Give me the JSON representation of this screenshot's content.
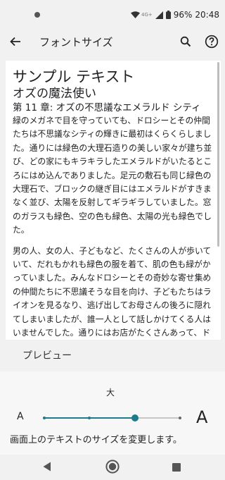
{
  "status_bar": {
    "network_label": "4G+",
    "battery": "96%",
    "time": "20:48"
  },
  "app_bar": {
    "title": "フォントサイズ",
    "back_icon": "arrow-back-icon",
    "search_icon": "search-icon",
    "help_icon": "help-icon"
  },
  "preview": {
    "sample_title": "サンプル テキスト",
    "book_title": "オズの魔法使い",
    "chapter": "第 11 章: オズの不思議なエメラルド シティ",
    "paragraphs": [
      "緑のメガネで目を守っていても、ドロシーとその仲間たちは不思議なシティの輝きに最初はくらくらしました。通りには緑色の大理石造りの美しい家々が建ち並び、どの家にもキラキラしたエメラルドがいたるところにはめ込んでありました。足元の敷石も同じ緑色の大理石で、ブロックの継ぎ目にはエメラルドがすきまなく並び、太陽を反射してギラギラしていました。窓のガラスも緑色、空の色も緑色、太陽の光も緑色でした。",
      "男の人、女の人、子どもなど、たくさんの人が歩いていて、だれもかれも緑色の服を着て、肌の色も緑がかっていました。みんなドロシーとその奇妙な寄せ集めの仲間たちに不思議そうな目を向け、子どもたちはライオンを見るなり、逃げ出してお母さんの後ろに隠れてしまいましたが、誰一人として話しかけてくる人はいませんでした。通りにはお店がたくさんあって、ドロシーはそこ"
    ]
  },
  "preview_label": "プレビュー",
  "font_size": {
    "current_label": "大",
    "small_a": "A",
    "large_a": "A",
    "levels": 4,
    "selected_index": 2,
    "accent_color": "#1f7a8c"
  },
  "description": "画面上のテキストのサイズを変更します。",
  "nav_bar": {
    "back_icon": "nav-back-icon",
    "home_icon": "nav-home-icon",
    "recents_icon": "nav-recents-icon"
  }
}
